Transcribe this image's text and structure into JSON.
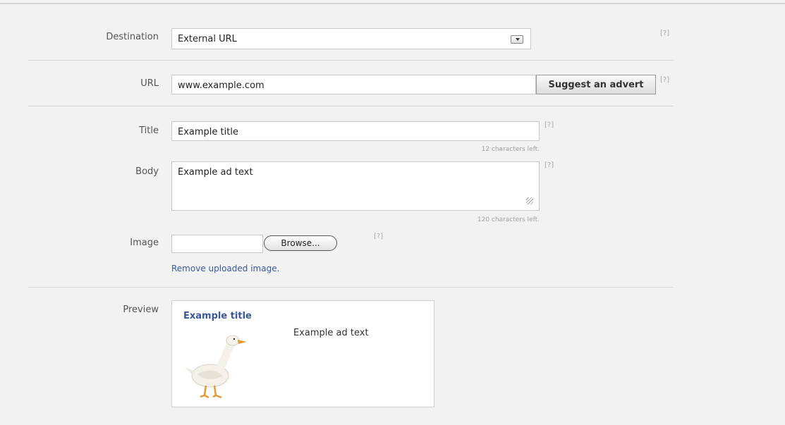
{
  "form": {
    "destination": {
      "label": "Destination",
      "value": "External URL",
      "help": "[?]"
    },
    "url": {
      "label": "URL",
      "value": "www.example.com",
      "suggest_button": "Suggest an advert",
      "help": "[?]"
    },
    "title": {
      "label": "Title",
      "value": "Example title",
      "counter": "12 characters left.",
      "help": "[?]"
    },
    "body": {
      "label": "Body",
      "value": "Example ad text",
      "counter": "120 characters left.",
      "help": "[?]"
    },
    "image": {
      "label": "Image",
      "browse_button": "Browse...",
      "remove_link": "Remove uploaded image.",
      "help": "[?]"
    },
    "preview": {
      "label": "Preview",
      "ad_title": "Example title",
      "ad_body": "Example ad text",
      "image_icon": "duck-image"
    }
  },
  "colors": {
    "link": "#3b5998",
    "background": "#f2f2f2"
  }
}
